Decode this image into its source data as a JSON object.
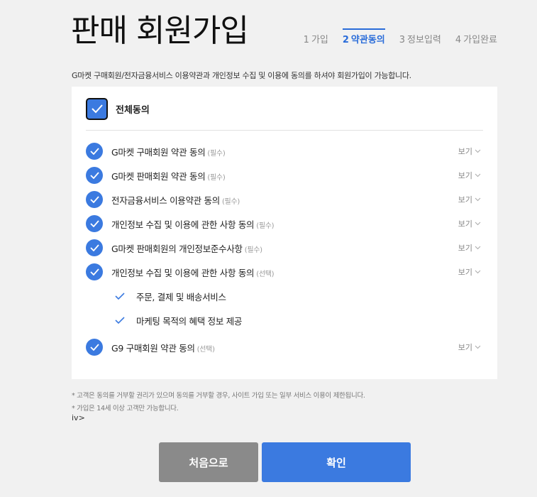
{
  "header": {
    "title": "판매 회원가입",
    "steps": [
      {
        "num": "1",
        "label": "가입",
        "active": false
      },
      {
        "num": "2",
        "label": "약관동의",
        "active": true
      },
      {
        "num": "3",
        "label": "정보입력",
        "active": false
      },
      {
        "num": "4",
        "label": "가입완료",
        "active": false
      }
    ]
  },
  "notice": "G마켓 구매회원/전자금융서비스 이용약관과 개인정보 수집 및 이용에 동의를 하셔야 회원가입이 가능합니다.",
  "agreement": {
    "all_label": "전체동의",
    "all_checked": true,
    "items": [
      {
        "label": "G마켓 구매회원 약관 동의",
        "tag": "(필수)",
        "view": "보기",
        "checked": true
      },
      {
        "label": "G마켓 판매회원 약관 동의",
        "tag": "(필수)",
        "view": "보기",
        "checked": true
      },
      {
        "label": "전자금융서비스 이용약관 동의",
        "tag": "(필수)",
        "view": "보기",
        "checked": true
      },
      {
        "label": "개인정보 수집 및 이용에 관한 사항 동의",
        "tag": "(필수)",
        "view": "보기",
        "checked": true
      },
      {
        "label": "G마켓 판매회원의 개인정보준수사항",
        "tag": "(필수)",
        "view": "보기",
        "checked": true
      },
      {
        "label": "개인정보 수집 및 이용에 관한 사항 동의",
        "tag": "(선택)",
        "view": "보기",
        "checked": true
      }
    ],
    "sub_items": [
      {
        "label": "주문, 결제 및 배송서비스",
        "checked": true
      },
      {
        "label": "마케팅 목적의 혜택 정보 제공",
        "checked": true
      }
    ],
    "last_item": {
      "label": "G9 구매회원 약관 동의",
      "tag": "(선택)",
      "view": "보기",
      "checked": true
    }
  },
  "footnotes": [
    "* 고객은 동의를 거부할 권리가 있으며 동의를 거부할 경우, 사이트 가입 또는 일부 서비스 이용이 제한됩니다.",
    "* 가입은 14세 이상 고객만 가능합니다."
  ],
  "fragment_text": "iv>",
  "buttons": {
    "reset": "처음으로",
    "confirm": "확인"
  },
  "colors": {
    "accent": "#3b7ae0",
    "reset_button": "#8a8a8a",
    "background": "#f1f1f1"
  }
}
